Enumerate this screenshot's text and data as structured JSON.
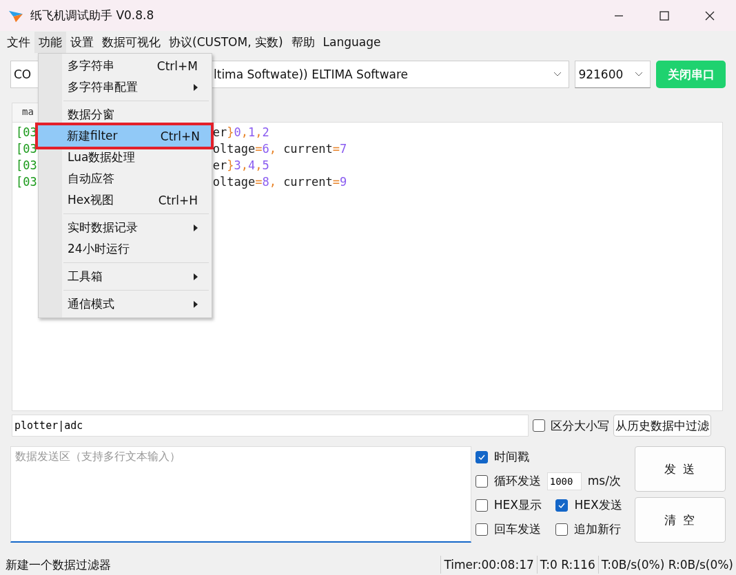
{
  "window": {
    "title": "纸飞机调试助手 V0.8.8"
  },
  "menubar": [
    {
      "label": "文件",
      "selected": false
    },
    {
      "label": "功能",
      "selected": true
    },
    {
      "label": "设置",
      "selected": false
    },
    {
      "label": "数据可视化",
      "selected": false
    },
    {
      "label": "协议(CUSTOM, 实数)",
      "selected": false
    },
    {
      "label": "帮助",
      "selected": false
    },
    {
      "label": "Language",
      "selected": false
    }
  ],
  "port_select": {
    "value_start": "CO",
    "value_end": "ltima Softwate)) ELTIMA Software"
  },
  "baud_select": {
    "value": "921600"
  },
  "close_port_button": "关闭串口",
  "tabs": [
    {
      "label": "ma",
      "selected": true
    }
  ],
  "log_lines": [
    {
      "start": "[03",
      "segments": [
        {
          "kind": "text",
          "text": "er"
        },
        {
          "kind": "punct",
          "text": "}"
        },
        {
          "kind": "number",
          "text": "0"
        },
        {
          "kind": "punct",
          "text": ","
        },
        {
          "kind": "number",
          "text": "1"
        },
        {
          "kind": "punct",
          "text": ","
        },
        {
          "kind": "number",
          "text": "2"
        }
      ]
    },
    {
      "start": "[03",
      "segments": [
        {
          "kind": "text",
          "text": "oltage"
        },
        {
          "kind": "punct",
          "text": "="
        },
        {
          "kind": "number",
          "text": "6"
        },
        {
          "kind": "punct",
          "text": ", "
        },
        {
          "kind": "text",
          "text": "current"
        },
        {
          "kind": "punct",
          "text": "="
        },
        {
          "kind": "number",
          "text": "7"
        }
      ]
    },
    {
      "start": "[03",
      "segments": [
        {
          "kind": "text",
          "text": "er"
        },
        {
          "kind": "punct",
          "text": "}"
        },
        {
          "kind": "number",
          "text": "3"
        },
        {
          "kind": "punct",
          "text": ","
        },
        {
          "kind": "number",
          "text": "4"
        },
        {
          "kind": "punct",
          "text": ","
        },
        {
          "kind": "number",
          "text": "5"
        }
      ]
    },
    {
      "start": "[03",
      "segments": [
        {
          "kind": "text",
          "text": "oltage"
        },
        {
          "kind": "punct",
          "text": "="
        },
        {
          "kind": "number",
          "text": "8"
        },
        {
          "kind": "punct",
          "text": ", "
        },
        {
          "kind": "text",
          "text": "current"
        },
        {
          "kind": "punct",
          "text": "="
        },
        {
          "kind": "number",
          "text": "9"
        }
      ]
    }
  ],
  "filter": {
    "value": "plotter|adc",
    "case_sensitive": {
      "label": "区分大小写",
      "checked": false
    },
    "button": "从历史数据中过滤"
  },
  "send_area": {
    "placeholder": "数据发送区（支持多行文本输入）"
  },
  "options": [
    {
      "label": "时间戳",
      "checked": true
    },
    {
      "label": "循环发送",
      "checked": false,
      "interval": "1000",
      "unit": "ms/次"
    },
    {
      "label": "HEX显示",
      "checked": false
    },
    {
      "label": "HEX发送",
      "checked": true
    },
    {
      "label": "回车发送",
      "checked": false
    },
    {
      "label": "追加新行",
      "checked": false
    }
  ],
  "send_button": "发 送",
  "clear_button": "清 空",
  "function_menu": {
    "sections": [
      [
        {
          "label": "多字符串",
          "shortcut": "Ctrl+M",
          "submenu": false,
          "selected": false
        },
        {
          "label": "多字符串配置",
          "submenu": true,
          "selected": false
        }
      ],
      [
        {
          "label": "数据分窗",
          "submenu": false,
          "selected": false
        },
        {
          "label": "新建filter",
          "shortcut": "Ctrl+N",
          "submenu": false,
          "selected": true,
          "highlighted": true
        },
        {
          "label": "Lua数据处理",
          "submenu": false,
          "selected": false
        },
        {
          "label": "自动应答",
          "submenu": false,
          "selected": false
        },
        {
          "label": "Hex视图",
          "shortcut": "Ctrl+H",
          "submenu": false,
          "selected": false
        }
      ],
      [
        {
          "label": "实时数据记录",
          "submenu": true,
          "selected": false
        },
        {
          "label": "24小时运行",
          "submenu": false,
          "selected": false
        }
      ],
      [
        {
          "label": "工具箱",
          "submenu": true,
          "selected": false
        }
      ],
      [
        {
          "label": "通信模式",
          "submenu": true,
          "selected": false
        }
      ]
    ]
  },
  "status_bar": {
    "message": "新建一个数据过滤器",
    "timer": "Timer:00:08:17",
    "counts": "T:0 R:116",
    "rates": "T:0B/s(0%) R:0B/s(0%)"
  }
}
